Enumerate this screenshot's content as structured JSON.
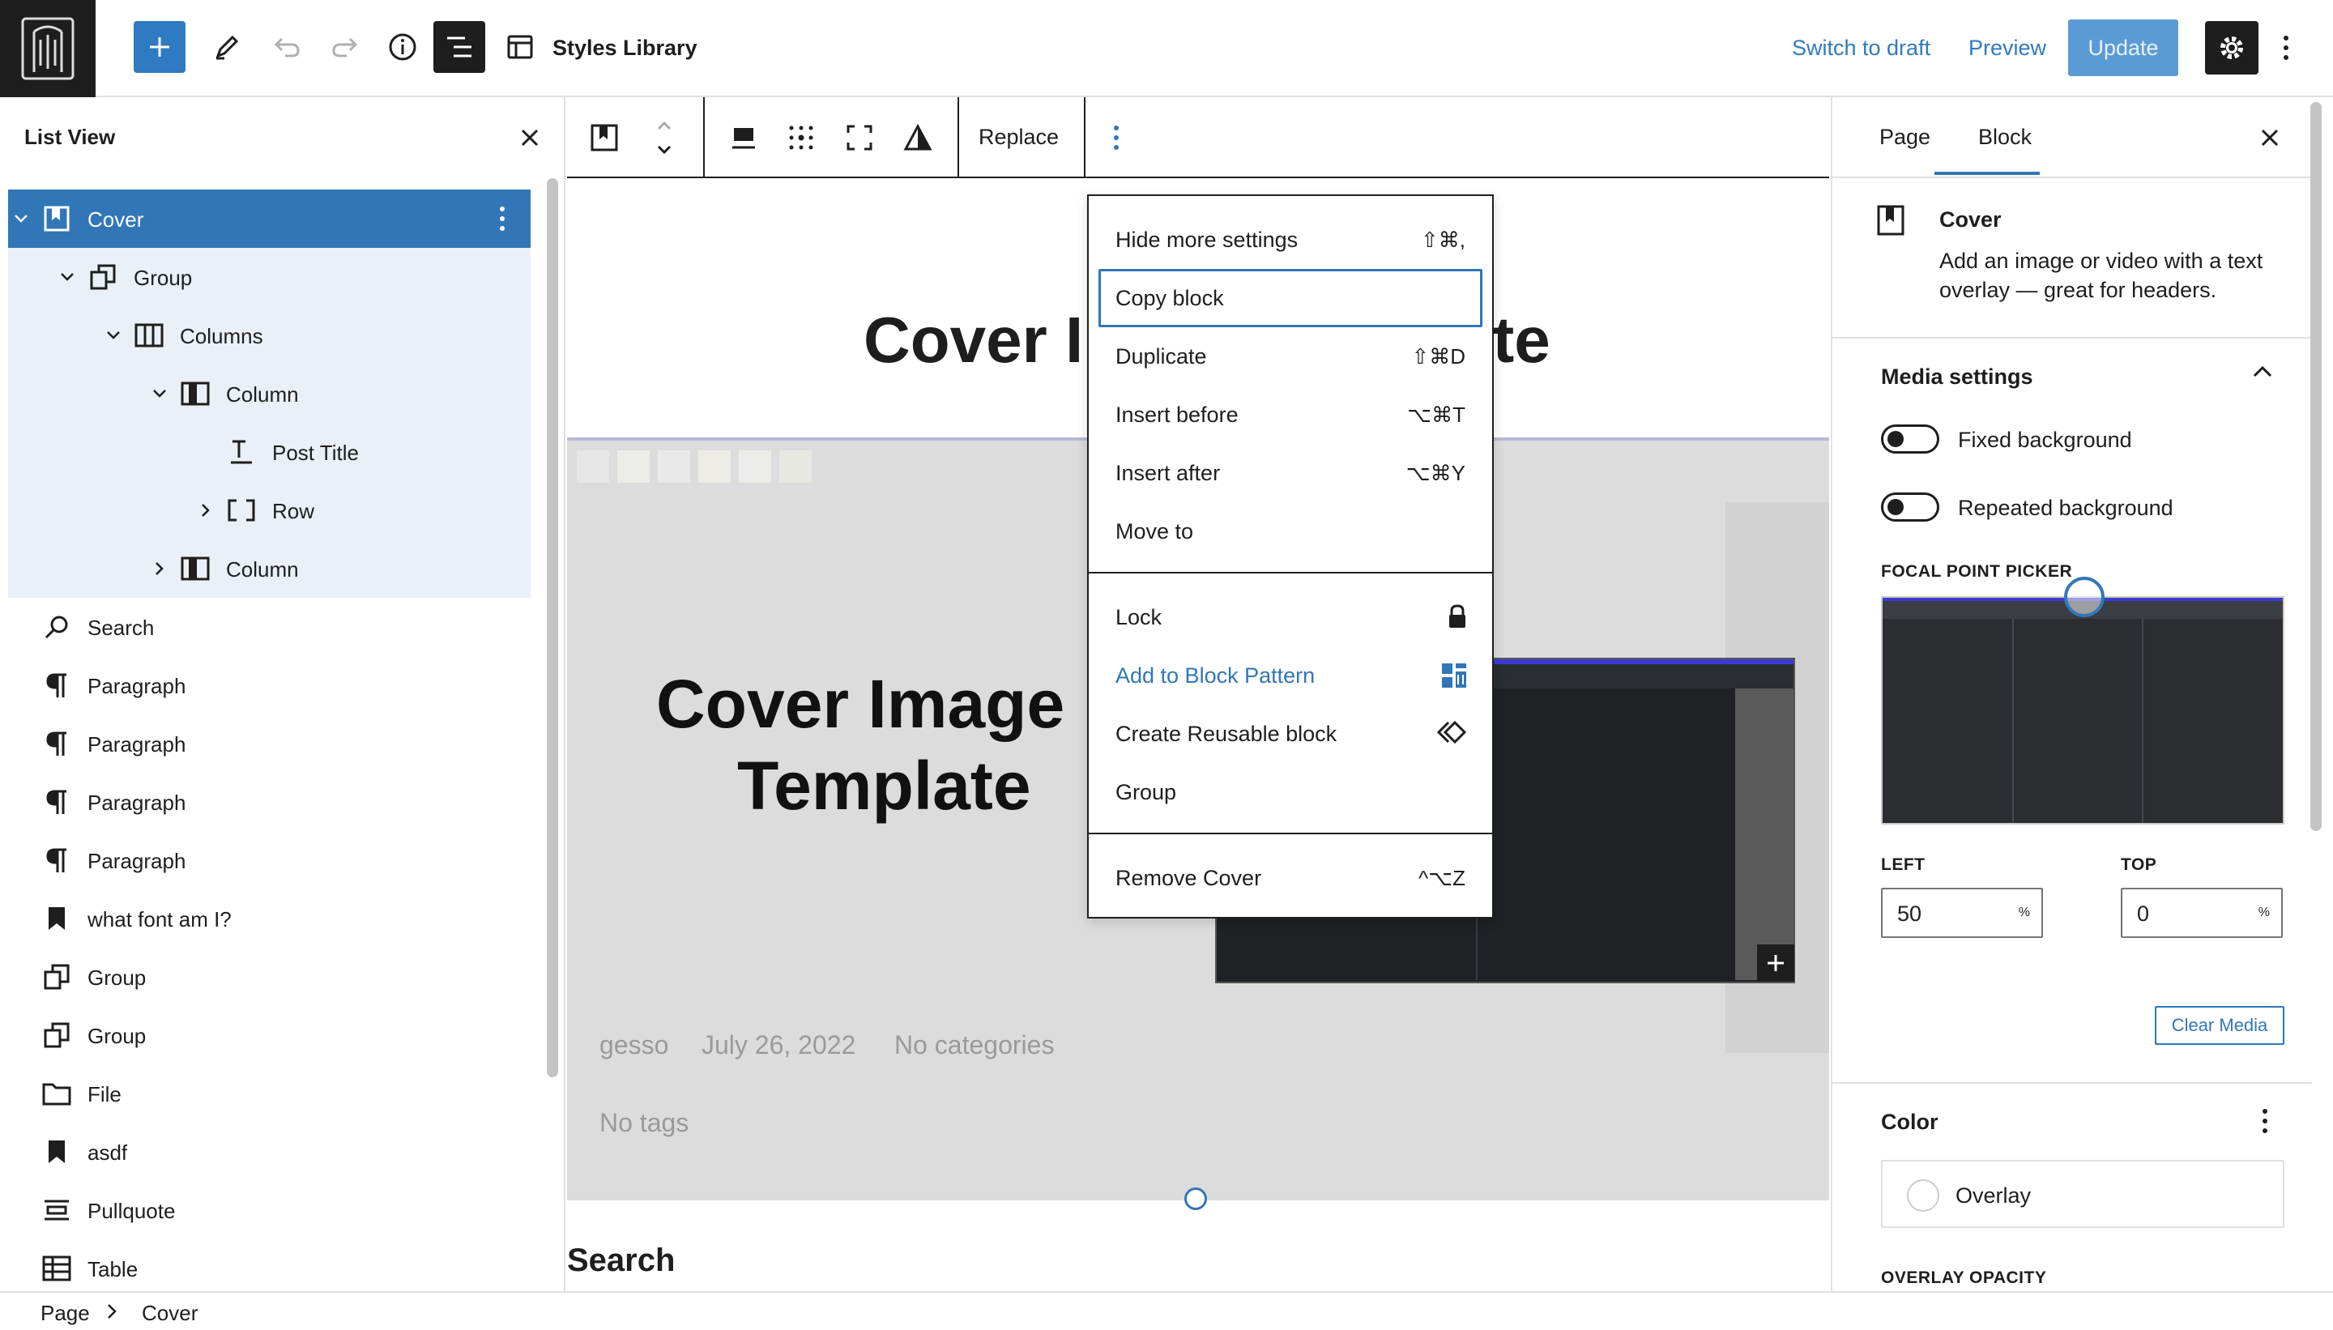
{
  "header": {
    "title": "Styles Library",
    "switch_to_draft": "Switch to draft",
    "preview": "Preview",
    "update": "Update"
  },
  "list_view": {
    "title": "List View",
    "items": [
      {
        "label": "Cover",
        "icon": "cover-icon",
        "level": 0,
        "expanded": true,
        "selected": true
      },
      {
        "label": "Group",
        "icon": "group-icon",
        "level": 1,
        "expanded": true
      },
      {
        "label": "Columns",
        "icon": "columns-icon",
        "level": 2,
        "expanded": true
      },
      {
        "label": "Column",
        "icon": "column-icon",
        "level": 3,
        "expanded": true
      },
      {
        "label": "Post Title",
        "icon": "post-title-icon",
        "level": 4
      },
      {
        "label": "Row",
        "icon": "row-icon",
        "level": 4,
        "expanded": false
      },
      {
        "label": "Column",
        "icon": "column-icon",
        "level": 3,
        "expanded": false
      },
      {
        "label": "Search",
        "icon": "search-icon",
        "level": 0
      },
      {
        "label": "Paragraph",
        "icon": "paragraph-icon",
        "level": 0
      },
      {
        "label": "Paragraph",
        "icon": "paragraph-icon",
        "level": 0
      },
      {
        "label": "Paragraph",
        "icon": "paragraph-icon",
        "level": 0
      },
      {
        "label": "Paragraph",
        "icon": "paragraph-icon",
        "level": 0
      },
      {
        "label": "what font am I?",
        "icon": "bookmark-icon",
        "level": 0
      },
      {
        "label": "Group",
        "icon": "group-icon",
        "level": 0
      },
      {
        "label": "Group",
        "icon": "group-icon",
        "level": 0
      },
      {
        "label": "File",
        "icon": "file-icon",
        "level": 0
      },
      {
        "label": "asdf",
        "icon": "bookmark-icon",
        "level": 0
      },
      {
        "label": "Pullquote",
        "icon": "pullquote-icon",
        "level": 0
      },
      {
        "label": "Table",
        "icon": "table-icon",
        "level": 0
      }
    ]
  },
  "block_toolbar": {
    "replace": "Replace"
  },
  "canvas": {
    "title": "Cover Image Template",
    "cover_heading_line1": "Cover Image",
    "cover_heading_line2": "Template",
    "author": "gesso",
    "date": "July 26, 2022",
    "categories": "No categories",
    "tags": "No tags",
    "search_heading": "Search"
  },
  "dropdown": {
    "group1": [
      {
        "label": "Hide more settings",
        "shortcut": "⇧⌘,"
      },
      {
        "label": "Copy block",
        "shortcut": ""
      },
      {
        "label": "Duplicate",
        "shortcut": "⇧⌘D"
      },
      {
        "label": "Insert before",
        "shortcut": "⌥⌘T"
      },
      {
        "label": "Insert after",
        "shortcut": "⌥⌘Y"
      },
      {
        "label": "Move to",
        "shortcut": ""
      }
    ],
    "group2": [
      {
        "label": "Lock",
        "icon": "lock-icon"
      },
      {
        "label": "Add to Block Pattern",
        "icon": "block-pattern-icon"
      },
      {
        "label": "Create Reusable block",
        "icon": "reusable-block-icon"
      },
      {
        "label": "Group",
        "icon": ""
      }
    ],
    "group3": [
      {
        "label": "Remove Cover",
        "shortcut": "^⌥Z"
      }
    ]
  },
  "settings": {
    "tabs": [
      "Page",
      "Block"
    ],
    "active_tab": "Block",
    "block_name": "Cover",
    "block_description": "Add an image or video with a text overlay — great for headers.",
    "media_settings": "Media settings",
    "fixed_background": "Fixed background",
    "repeated_background": "Repeated background",
    "focal_point_picker": "FOCAL POINT PICKER",
    "left_label": "LEFT",
    "left_value": "50",
    "top_label": "TOP",
    "top_value": "0",
    "unit": "%",
    "clear_media": "Clear Media",
    "color_heading": "Color",
    "overlay": "Overlay",
    "overlay_opacity": "OVERLAY OPACITY"
  },
  "breadcrumb": {
    "root": "Page",
    "current": "Cover"
  },
  "colors": {
    "accent": "#3177b8",
    "dark": "#1e1e1e"
  }
}
